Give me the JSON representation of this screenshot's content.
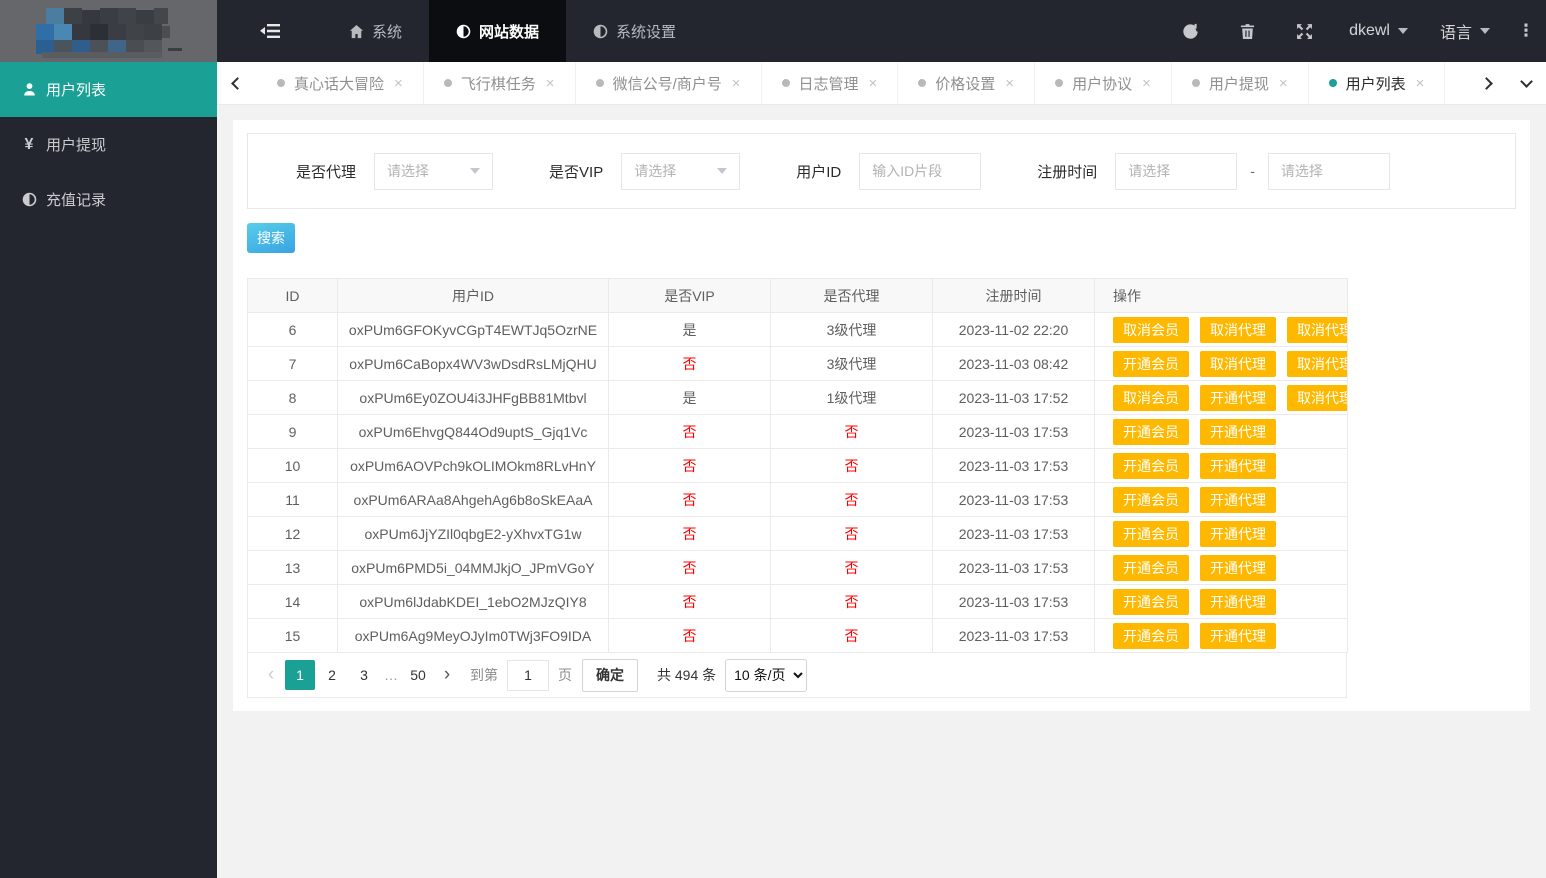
{
  "colors": {
    "dark": "#23262e",
    "nav_active_bg": "#0c0d10",
    "teal": "#1aa094",
    "orange": "#ffb800",
    "red": "#ff0000",
    "page_bg": "#f2f2f2",
    "grad1": "#57cee9",
    "grad2": "#3aa2e1"
  },
  "navbar": {
    "items": [
      {
        "label": "系统",
        "icon": "home-icon",
        "active": false
      },
      {
        "label": "网站数据",
        "icon": "half-circle-icon",
        "active": true
      },
      {
        "label": "系统设置",
        "icon": "half-circle-icon",
        "active": false
      }
    ],
    "username": "dkewl",
    "language_label": "语言",
    "more_glyph": "⋮"
  },
  "sidebar": {
    "items": [
      {
        "label": "用户列表",
        "icon": "user-icon",
        "active": true
      },
      {
        "label": "用户提现",
        "icon": "yen-icon",
        "active": false
      },
      {
        "label": "充值记录",
        "icon": "half-circle-icon",
        "active": false
      }
    ]
  },
  "tabs": {
    "items": [
      {
        "label": "真心话大冒险",
        "active": false
      },
      {
        "label": "飞行棋任务",
        "active": false
      },
      {
        "label": "微信公号/商户号",
        "active": false
      },
      {
        "label": "日志管理",
        "active": false
      },
      {
        "label": "价格设置",
        "active": false
      },
      {
        "label": "用户协议",
        "active": false
      },
      {
        "label": "用户提现",
        "active": false
      },
      {
        "label": "用户列表",
        "active": true
      }
    ],
    "close_glyph": "×"
  },
  "filters": {
    "agent_label": "是否代理",
    "agent_placeholder": "请选择",
    "vip_label": "是否VIP",
    "vip_placeholder": "请选择",
    "userid_label": "用户ID",
    "userid_placeholder": "输入ID片段",
    "regtime_label": "注册时间",
    "regtime_start_placeholder": "请选择",
    "regtime_end_placeholder": "请选择",
    "range_separator": "-"
  },
  "search_button_label": "搜索",
  "table": {
    "headers": [
      "ID",
      "用户ID",
      "是否VIP",
      "是否代理",
      "注册时间",
      "操作"
    ],
    "negative_value": "否",
    "rows": [
      {
        "id": "6",
        "user_id": "oxPUm6GFOKyvCGpT4EWTJq5OzrNE",
        "vip": "是",
        "agent": "3级代理",
        "reg_time": "2023-11-02 22:20",
        "actions": [
          "取消会员",
          "取消代理",
          "取消代理"
        ]
      },
      {
        "id": "7",
        "user_id": "oxPUm6CaBopx4WV3wDsdRsLMjQHU",
        "vip": "否",
        "agent": "3级代理",
        "reg_time": "2023-11-03 08:42",
        "actions": [
          "开通会员",
          "取消代理",
          "取消代理"
        ]
      },
      {
        "id": "8",
        "user_id": "oxPUm6Ey0ZOU4i3JHFgBB81Mtbvl",
        "vip": "是",
        "agent": "1级代理",
        "reg_time": "2023-11-03 17:52",
        "actions": [
          "取消会员",
          "开通代理",
          "取消代理"
        ]
      },
      {
        "id": "9",
        "user_id": "oxPUm6EhvgQ844Od9uptS_Gjq1Vc",
        "vip": "否",
        "agent": "否",
        "reg_time": "2023-11-03 17:53",
        "actions": [
          "开通会员",
          "开通代理"
        ]
      },
      {
        "id": "10",
        "user_id": "oxPUm6AOVPch9kOLIMOkm8RLvHnY",
        "vip": "否",
        "agent": "否",
        "reg_time": "2023-11-03 17:53",
        "actions": [
          "开通会员",
          "开通代理"
        ]
      },
      {
        "id": "11",
        "user_id": "oxPUm6ARAa8AhgehAg6b8oSkEAaA",
        "vip": "否",
        "agent": "否",
        "reg_time": "2023-11-03 17:53",
        "actions": [
          "开通会员",
          "开通代理"
        ]
      },
      {
        "id": "12",
        "user_id": "oxPUm6JjYZIl0qbgE2-yXhvxTG1w",
        "vip": "否",
        "agent": "否",
        "reg_time": "2023-11-03 17:53",
        "actions": [
          "开通会员",
          "开通代理"
        ]
      },
      {
        "id": "13",
        "user_id": "oxPUm6PMD5i_04MMJkjO_JPmVGoY",
        "vip": "否",
        "agent": "否",
        "reg_time": "2023-11-03 17:53",
        "actions": [
          "开通会员",
          "开通代理"
        ]
      },
      {
        "id": "14",
        "user_id": "oxPUm6lJdabKDEI_1ebO2MJzQIY8",
        "vip": "否",
        "agent": "否",
        "reg_time": "2023-11-03 17:53",
        "actions": [
          "开通会员",
          "开通代理"
        ]
      },
      {
        "id": "15",
        "user_id": "oxPUm6Ag9MeyOJyIm0TWj3FO9IDA",
        "vip": "否",
        "agent": "否",
        "reg_time": "2023-11-03 17:53",
        "actions": [
          "开通会员",
          "开通代理"
        ]
      }
    ]
  },
  "pagination": {
    "pages": [
      "1",
      "2",
      "3",
      "...",
      "50"
    ],
    "active_page": "1",
    "goto_label": "到第",
    "goto_value": "1",
    "page_word": "页",
    "confirm_label": "确定",
    "total_text": "共 494 条",
    "per_page": "10 条/页"
  }
}
